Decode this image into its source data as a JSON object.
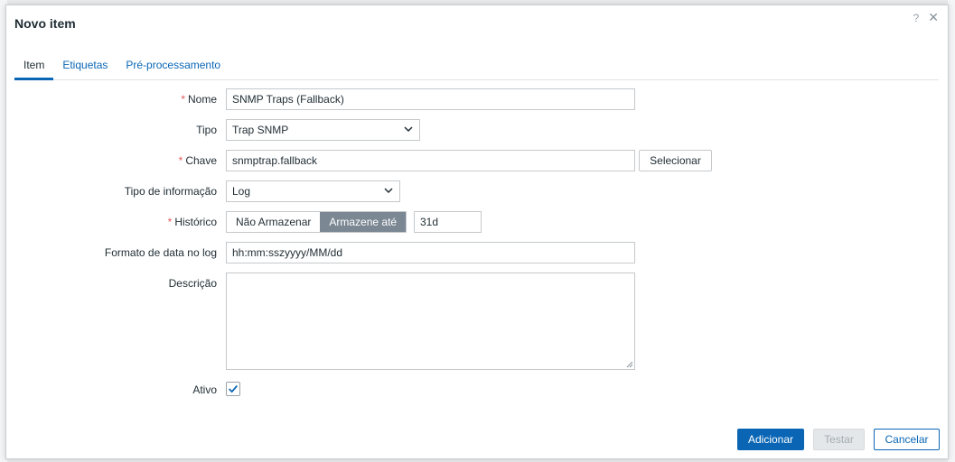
{
  "dialog": {
    "title": "Novo item",
    "help_icon": "?",
    "close_icon": "✕"
  },
  "tabs": [
    {
      "label": "Item",
      "active": true
    },
    {
      "label": "Etiquetas",
      "active": false
    },
    {
      "label": "Pré-processamento",
      "active": false
    }
  ],
  "form": {
    "required_marker": "*",
    "name": {
      "label": "Nome",
      "value": "SNMP Traps (Fallback)"
    },
    "type": {
      "label": "Tipo",
      "value": "Trap SNMP"
    },
    "key": {
      "label": "Chave",
      "value": "snmptrap.fallback",
      "select_label": "Selecionar"
    },
    "info_type": {
      "label": "Tipo de informação",
      "value": "Log"
    },
    "history": {
      "label": "Histórico",
      "option_no": "Não Armazenar",
      "option_yes": "Armazene até",
      "value": "31d"
    },
    "log_format": {
      "label": "Formato de data no log",
      "value": "hh:mm:sszyyyy/MM/dd"
    },
    "description": {
      "label": "Descrição",
      "value": ""
    },
    "enabled": {
      "label": "Ativo",
      "checked": true
    }
  },
  "footer": {
    "add_label": "Adicionar",
    "test_label": "Testar",
    "cancel_label": "Cancelar"
  },
  "colors": {
    "accent": "#0a66b5",
    "required": "#e45959",
    "segment_active": "#7b8793"
  }
}
